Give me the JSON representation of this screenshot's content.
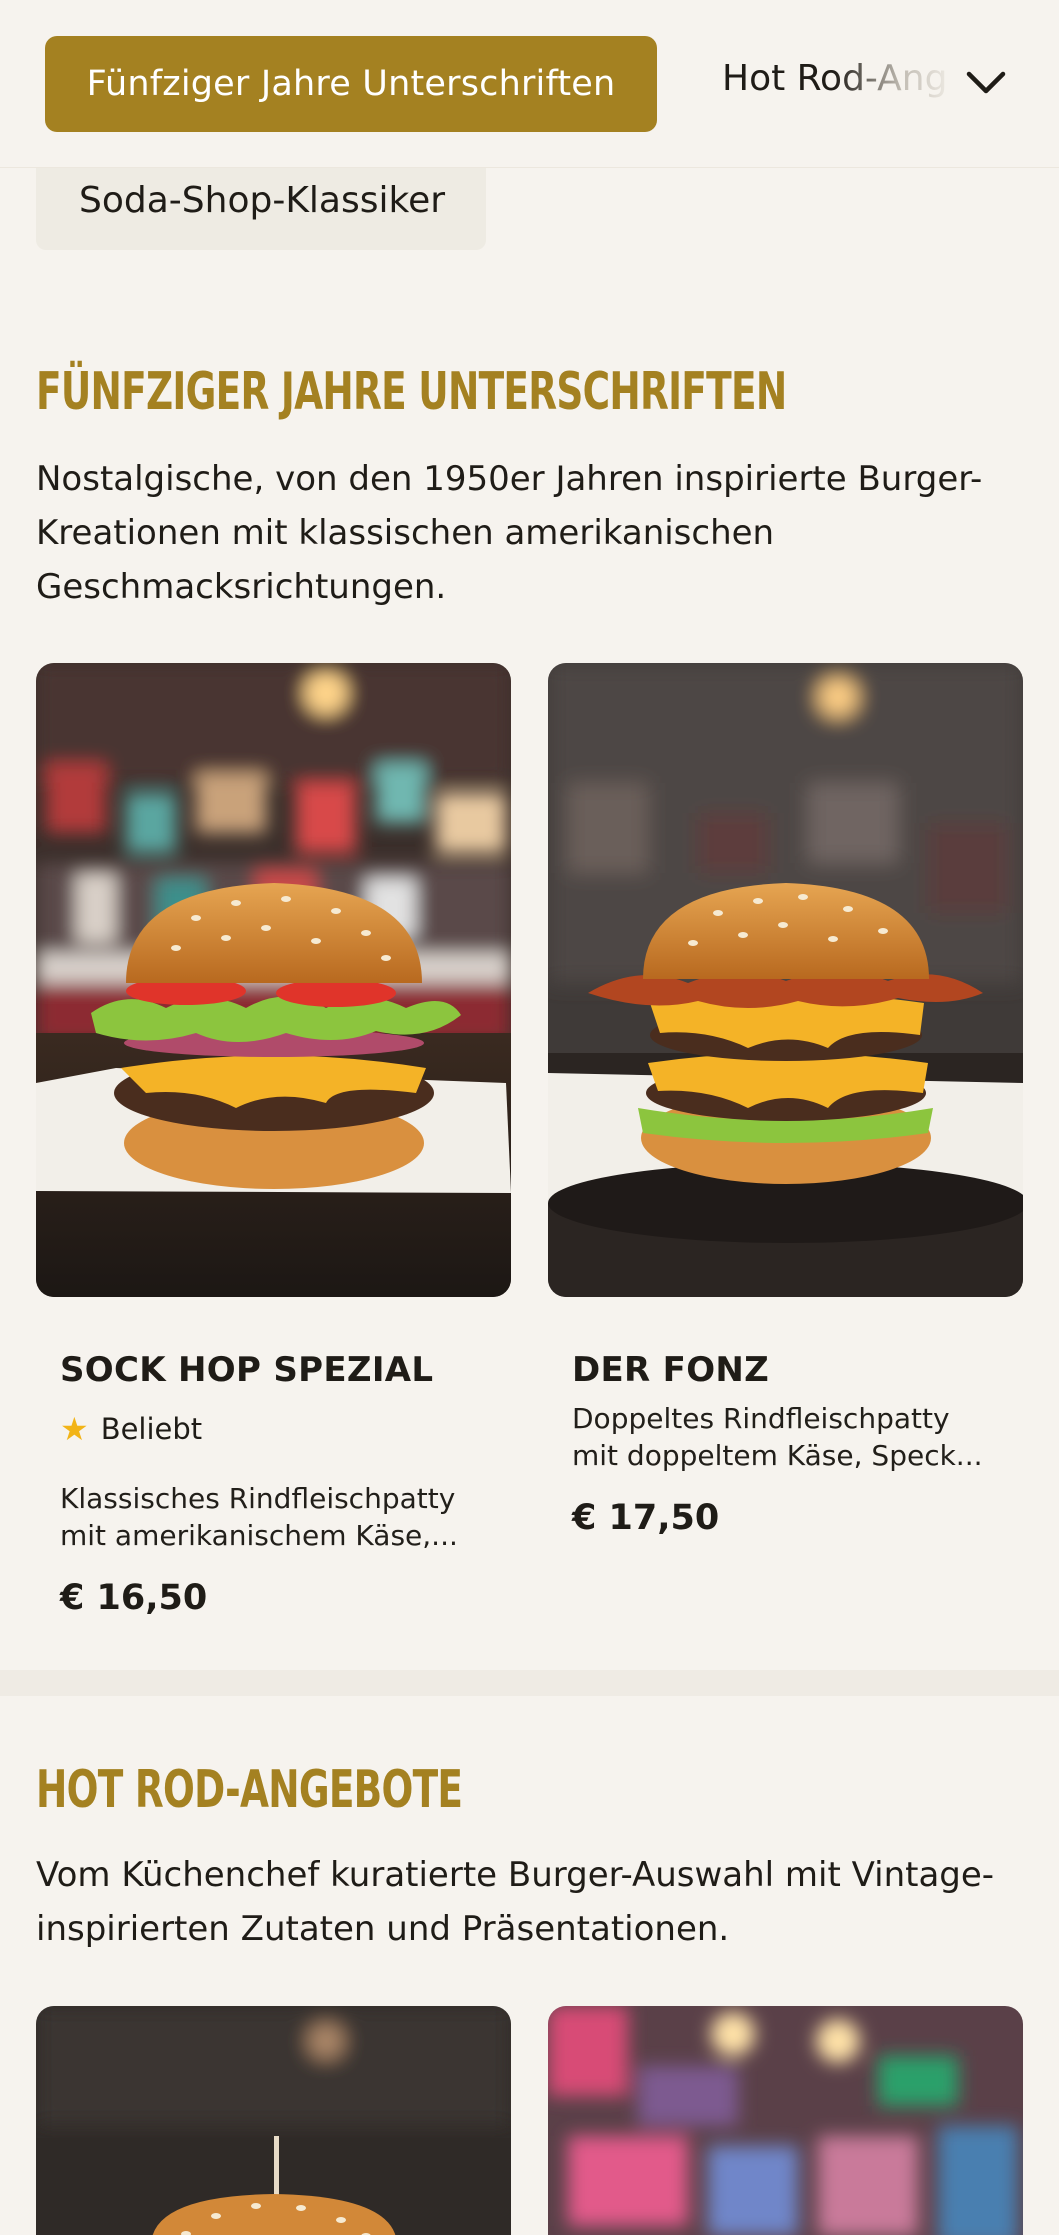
{
  "nav": {
    "active_category": "Fünfziger Jahre Unterschriften",
    "next_category": "Hot Rod-Angebote",
    "next_category_visible": "Hot Rod-Ang",
    "extra_category": "Soda-Shop-Klassiker"
  },
  "sections": [
    {
      "title": "FÜNFZIGER JAHRE UNTERSCHRIFTEN",
      "description": "Nostalgische, von den 1950er Jahren inspirierte Burger-Kreationen mit klassischen amerikanischen Geschmacksrichtungen.",
      "items": [
        {
          "name": "SOCK HOP SPEZIAL",
          "badge": "Beliebt",
          "badge_icon": "star-icon",
          "description_line1": "Klassisches Rindfleischpatty",
          "description_line2": "mit amerikanischem Käse,...",
          "price": "€ 16,50"
        },
        {
          "name": "DER FONZ",
          "description_line1": "Doppeltes Rindfleischpatty",
          "description_line2": "mit doppeltem Käse, Speck...",
          "price": "€ 17,50"
        }
      ]
    },
    {
      "title": "HOT ROD-ANGEBOTE",
      "description": "Vom Küchenchef kuratierte Burger-Auswahl mit Vintage-inspirierten Zutaten und Präsentationen."
    }
  ],
  "colors": {
    "accent": "#a48121",
    "background": "#f6f3ee",
    "star": "#f2b417"
  }
}
